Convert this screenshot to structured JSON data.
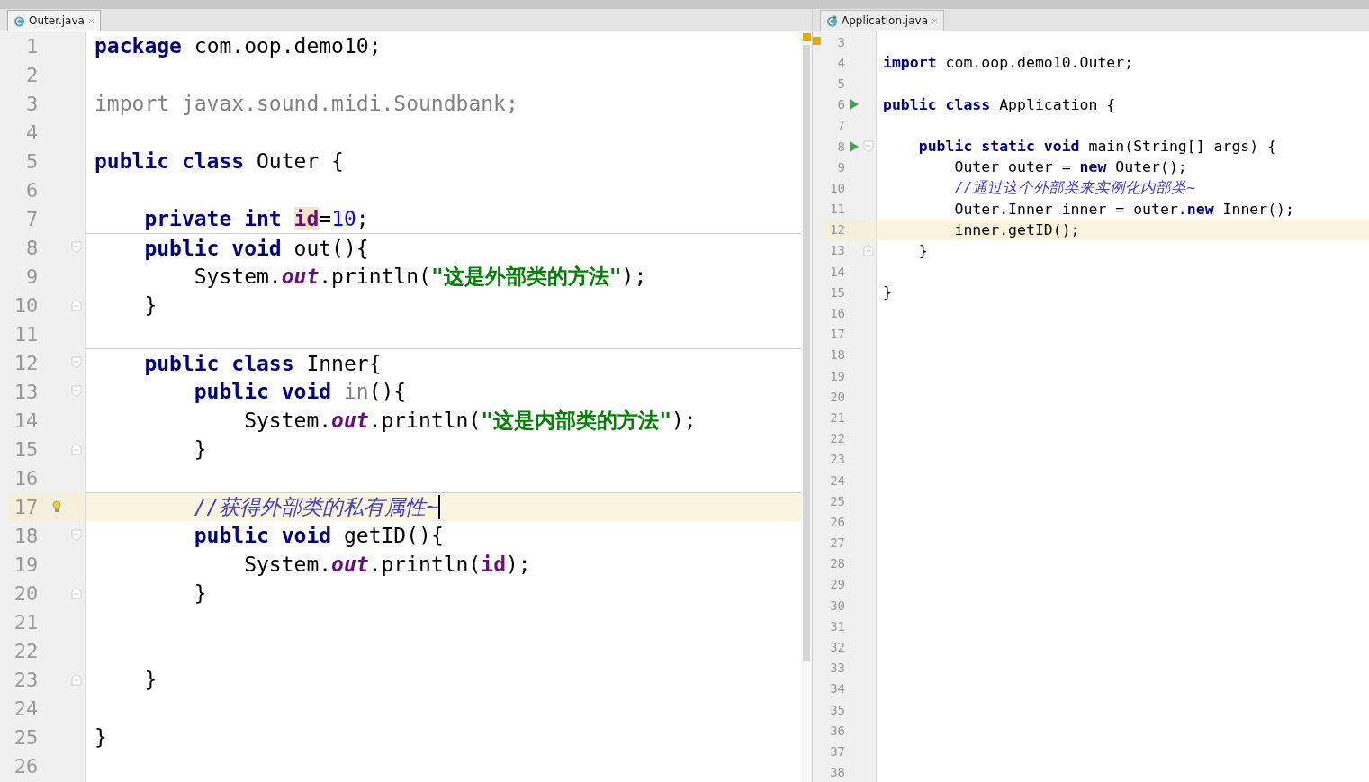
{
  "editors": [
    {
      "tab": {
        "label": "Outer.java",
        "selected": true
      },
      "lines": [
        {
          "number": "1",
          "tokens": [
            {
              "kind": "kw",
              "text": "package"
            },
            {
              "kind": "plain",
              "text": " com.oop.demo10;"
            }
          ]
        },
        {
          "number": "2"
        },
        {
          "number": "3",
          "tokens": [
            {
              "kind": "unused",
              "text": "import javax.sound.midi.Soundbank;"
            }
          ]
        },
        {
          "number": "4"
        },
        {
          "number": "5",
          "tokens": [
            {
              "kind": "kw",
              "text": "public class"
            },
            {
              "kind": "plain",
              "text": " Outer {"
            }
          ]
        },
        {
          "number": "6"
        },
        {
          "number": "7",
          "tokens": [
            {
              "kind": "kw",
              "text": "    private int "
            },
            {
              "kind": "field-hl",
              "text": "id"
            },
            {
              "kind": "plain",
              "text": "="
            },
            {
              "kind": "num",
              "text": "10"
            },
            {
              "kind": "plain",
              "text": ";"
            }
          ]
        },
        {
          "number": "8",
          "separator": true,
          "fold_start": true,
          "tokens": [
            {
              "kind": "kw",
              "text": "    public void"
            },
            {
              "kind": "plain",
              "text": " out(){"
            }
          ]
        },
        {
          "number": "9",
          "tokens": [
            {
              "kind": "plain",
              "text": "        System."
            },
            {
              "kind": "static",
              "text": "out"
            },
            {
              "kind": "plain",
              "text": ".println("
            },
            {
              "kind": "str",
              "text": "\"这是外部类的方法\""
            },
            {
              "kind": "plain",
              "text": ");"
            }
          ]
        },
        {
          "number": "10",
          "fold_end": true,
          "tokens": [
            {
              "kind": "plain",
              "text": "    }"
            }
          ]
        },
        {
          "number": "11"
        },
        {
          "number": "12",
          "separator": true,
          "fold_start": true,
          "tokens": [
            {
              "kind": "kw",
              "text": "    public class"
            },
            {
              "kind": "plain",
              "text": " Inner{"
            }
          ]
        },
        {
          "number": "13",
          "fold_start": true,
          "tokens": [
            {
              "kind": "kw",
              "text": "        public void"
            },
            {
              "kind": "unused",
              "text": " in"
            },
            {
              "kind": "plain",
              "text": "(){"
            }
          ]
        },
        {
          "number": "14",
          "tokens": [
            {
              "kind": "plain",
              "text": "            System."
            },
            {
              "kind": "static",
              "text": "out"
            },
            {
              "kind": "plain",
              "text": ".println("
            },
            {
              "kind": "str",
              "text": "\"这是内部类的方法\""
            },
            {
              "kind": "plain",
              "text": ");"
            }
          ]
        },
        {
          "number": "15",
          "fold_end": true,
          "tokens": [
            {
              "kind": "plain",
              "text": "        }"
            }
          ]
        },
        {
          "number": "16"
        },
        {
          "number": "17",
          "separator": true,
          "current": true,
          "caret": true,
          "bulb": true,
          "tokens": [
            {
              "kind": "comment",
              "text": "        //获得外部类的私有属性~"
            }
          ]
        },
        {
          "number": "18",
          "fold_start": true,
          "tokens": [
            {
              "kind": "kw",
              "text": "        public void"
            },
            {
              "kind": "plain",
              "text": " getID(){"
            }
          ]
        },
        {
          "number": "19",
          "tokens": [
            {
              "kind": "plain",
              "text": "            System."
            },
            {
              "kind": "static",
              "text": "out"
            },
            {
              "kind": "plain",
              "text": ".println("
            },
            {
              "kind": "field",
              "text": "id"
            },
            {
              "kind": "plain",
              "text": ");"
            }
          ]
        },
        {
          "number": "20",
          "fold_end": true,
          "tokens": [
            {
              "kind": "plain",
              "text": "        }"
            }
          ]
        },
        {
          "number": "21"
        },
        {
          "number": "22"
        },
        {
          "number": "23",
          "fold_end": true,
          "tokens": [
            {
              "kind": "plain",
              "text": "    }"
            }
          ]
        },
        {
          "number": "24"
        },
        {
          "number": "25",
          "tokens": [
            {
              "kind": "plain",
              "text": "}"
            }
          ]
        },
        {
          "number": "26"
        }
      ]
    },
    {
      "tab": {
        "label": "Application.java",
        "selected": false
      },
      "lines": [
        {
          "number": "3"
        },
        {
          "number": "4",
          "tokens": [
            {
              "kind": "kw",
              "text": "import"
            },
            {
              "kind": "plain",
              "text": " com.oop.demo10.Outer;"
            }
          ]
        },
        {
          "number": "5"
        },
        {
          "number": "6",
          "runnable": true,
          "tokens": [
            {
              "kind": "kw",
              "text": "public class"
            },
            {
              "kind": "plain",
              "text": " Application {"
            }
          ]
        },
        {
          "number": "7"
        },
        {
          "number": "8",
          "runnable": true,
          "fold_start": true,
          "tokens": [
            {
              "kind": "kw",
              "text": "    public static void"
            },
            {
              "kind": "plain",
              "text": " main(String[] args) {"
            }
          ]
        },
        {
          "number": "9",
          "tokens": [
            {
              "kind": "plain",
              "text": "        Outer outer = "
            },
            {
              "kind": "kw",
              "text": "new"
            },
            {
              "kind": "plain",
              "text": " Outer();"
            }
          ]
        },
        {
          "number": "10",
          "tokens": [
            {
              "kind": "comment",
              "text": "        //通过这个外部类来实例化内部类~"
            }
          ]
        },
        {
          "number": "11",
          "tokens": [
            {
              "kind": "plain",
              "text": "        Outer.Inner inner = outer."
            },
            {
              "kind": "kw",
              "text": "new"
            },
            {
              "kind": "plain",
              "text": " Inner();"
            }
          ]
        },
        {
          "number": "12",
          "current": true,
          "tokens": [
            {
              "kind": "plain",
              "text": "        inner.getID();"
            }
          ]
        },
        {
          "number": "13",
          "fold_end": true,
          "tokens": [
            {
              "kind": "plain",
              "text": "    }"
            }
          ]
        },
        {
          "number": "14"
        },
        {
          "number": "15",
          "tokens": [
            {
              "kind": "plain",
              "text": "}"
            }
          ]
        },
        {
          "number": "16"
        },
        {
          "number": "17"
        },
        {
          "number": "18"
        },
        {
          "number": "19"
        },
        {
          "number": "20"
        },
        {
          "number": "21"
        },
        {
          "number": "22"
        },
        {
          "number": "23"
        },
        {
          "number": "24"
        },
        {
          "number": "25"
        },
        {
          "number": "26"
        },
        {
          "number": "27"
        },
        {
          "number": "28"
        },
        {
          "number": "29"
        },
        {
          "number": "30"
        },
        {
          "number": "31"
        },
        {
          "number": "32"
        },
        {
          "number": "33"
        },
        {
          "number": "34"
        },
        {
          "number": "35"
        },
        {
          "number": "36"
        },
        {
          "number": "37"
        },
        {
          "number": "38"
        }
      ]
    }
  ]
}
